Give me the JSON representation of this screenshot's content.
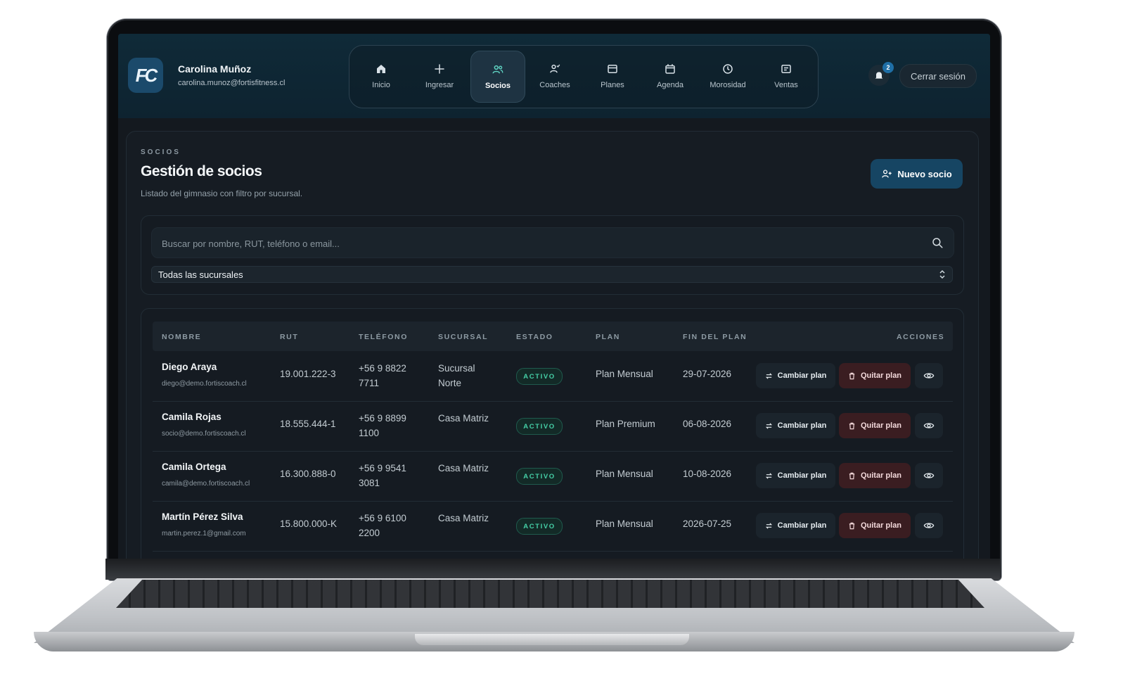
{
  "user": {
    "initials": "FC",
    "name": "Carolina Muñoz",
    "email": "carolina.munoz@fortisfitness.cl"
  },
  "nav": [
    {
      "label": "Inicio",
      "icon": "home-icon"
    },
    {
      "label": "Ingresar",
      "icon": "plus-icon"
    },
    {
      "label": "Socios",
      "icon": "users-icon",
      "active": true
    },
    {
      "label": "Coaches",
      "icon": "coach-icon"
    },
    {
      "label": "Planes",
      "icon": "card-icon"
    },
    {
      "label": "Agenda",
      "icon": "calendar-icon"
    },
    {
      "label": "Morosidad",
      "icon": "clock-icon"
    },
    {
      "label": "Ventas",
      "icon": "receipt-icon"
    }
  ],
  "notifications": {
    "count": "2"
  },
  "logout_label": "Cerrar sesión",
  "page": {
    "eyebrow": "SOCIOS",
    "title": "Gestión de socios",
    "subtitle": "Listado del gimnasio con filtro por sucursal.",
    "new_button": "Nuevo socio"
  },
  "filters": {
    "search_placeholder": "Buscar por nombre, RUT, teléfono o email...",
    "branch_selected": "Todas las sucursales"
  },
  "table": {
    "headers": [
      "NOMBRE",
      "RUT",
      "TELÉFONO",
      "SUCURSAL",
      "ESTADO",
      "PLAN",
      "FIN DEL PLAN",
      "ACCIONES"
    ],
    "rows": [
      {
        "name": "Diego Araya",
        "email": "diego@demo.fortiscoach.cl",
        "rut": "19.001.222-3",
        "phone_1": "+56 9 8822",
        "phone_2": "7711",
        "branch_1": "Sucursal",
        "branch_2": "Norte",
        "status": "ACTIVO",
        "plan": "Plan Mensual",
        "end": "29-07-2026"
      },
      {
        "name": "Camila Rojas",
        "email": "socio@demo.fortiscoach.cl",
        "rut": "18.555.444-1",
        "phone_1": "+56 9 8899",
        "phone_2": "1100",
        "branch_1": "Casa Matriz",
        "branch_2": "",
        "status": "ACTIVO",
        "plan": "Plan Premium",
        "end": "06-08-2026"
      },
      {
        "name": "Camila Ortega",
        "email": "camila@demo.fortiscoach.cl",
        "rut": "16.300.888-0",
        "phone_1": "+56 9 9541",
        "phone_2": "3081",
        "branch_1": "Casa Matriz",
        "branch_2": "",
        "status": "ACTIVO",
        "plan": "Plan Mensual",
        "end": "10-08-2026"
      },
      {
        "name": "Martín Pérez Silva",
        "email": "martin.perez.1@gmail.com",
        "rut": "15.800.000-K",
        "phone_1": "+56 9 6100",
        "phone_2": "2200",
        "branch_1": "Casa Matriz",
        "branch_2": "",
        "status": "ACTIVO",
        "plan": "Plan Mensual",
        "end": "2026-07-25"
      }
    ],
    "actions": {
      "change": "Cambiar plan",
      "remove": "Quitar plan"
    }
  },
  "colors": {
    "accent": "#164563",
    "active_status": "#45d0a7",
    "danger_bg": "#3a1d21"
  }
}
